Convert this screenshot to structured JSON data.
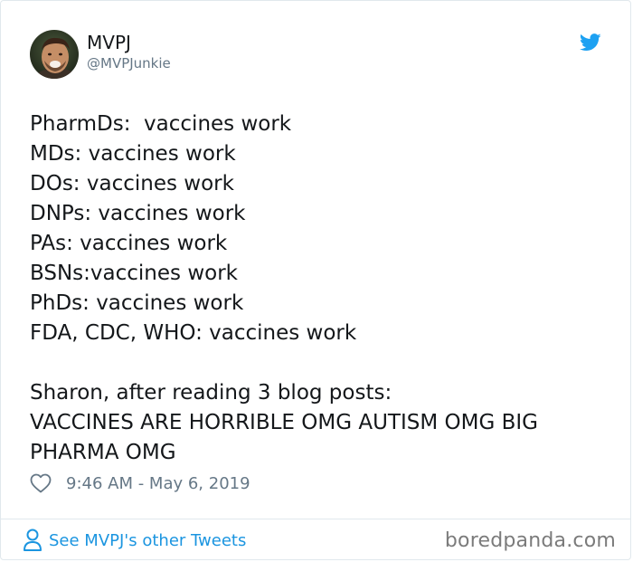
{
  "user": {
    "display_name": "MVPJ",
    "handle": "@MVPJunkie"
  },
  "tweet": {
    "text": "PharmDs:  vaccines work\nMDs: vaccines work\nDOs: vaccines work\nDNPs: vaccines work\nPAs: vaccines work\nBSNs:vaccines work\nPhDs: vaccines work\nFDA, CDC, WHO: vaccines work\n\nSharon, after reading 3 blog posts:\nVACCINES ARE HORRIBLE OMG AUTISM OMG BIG PHARMA OMG",
    "timestamp": "9:46 AM - May 6, 2019"
  },
  "footer": {
    "other_tweets_label": "See MVPJ's other Tweets"
  },
  "watermark": "boredpanda.com",
  "icons": {
    "brand": "twitter-bird-icon",
    "like": "heart-icon",
    "profile": "person-icon"
  },
  "colors": {
    "twitter_blue": "#1da1f2",
    "link_blue": "#1b95e0",
    "muted_text": "#657786",
    "border": "#e1e8ed"
  }
}
